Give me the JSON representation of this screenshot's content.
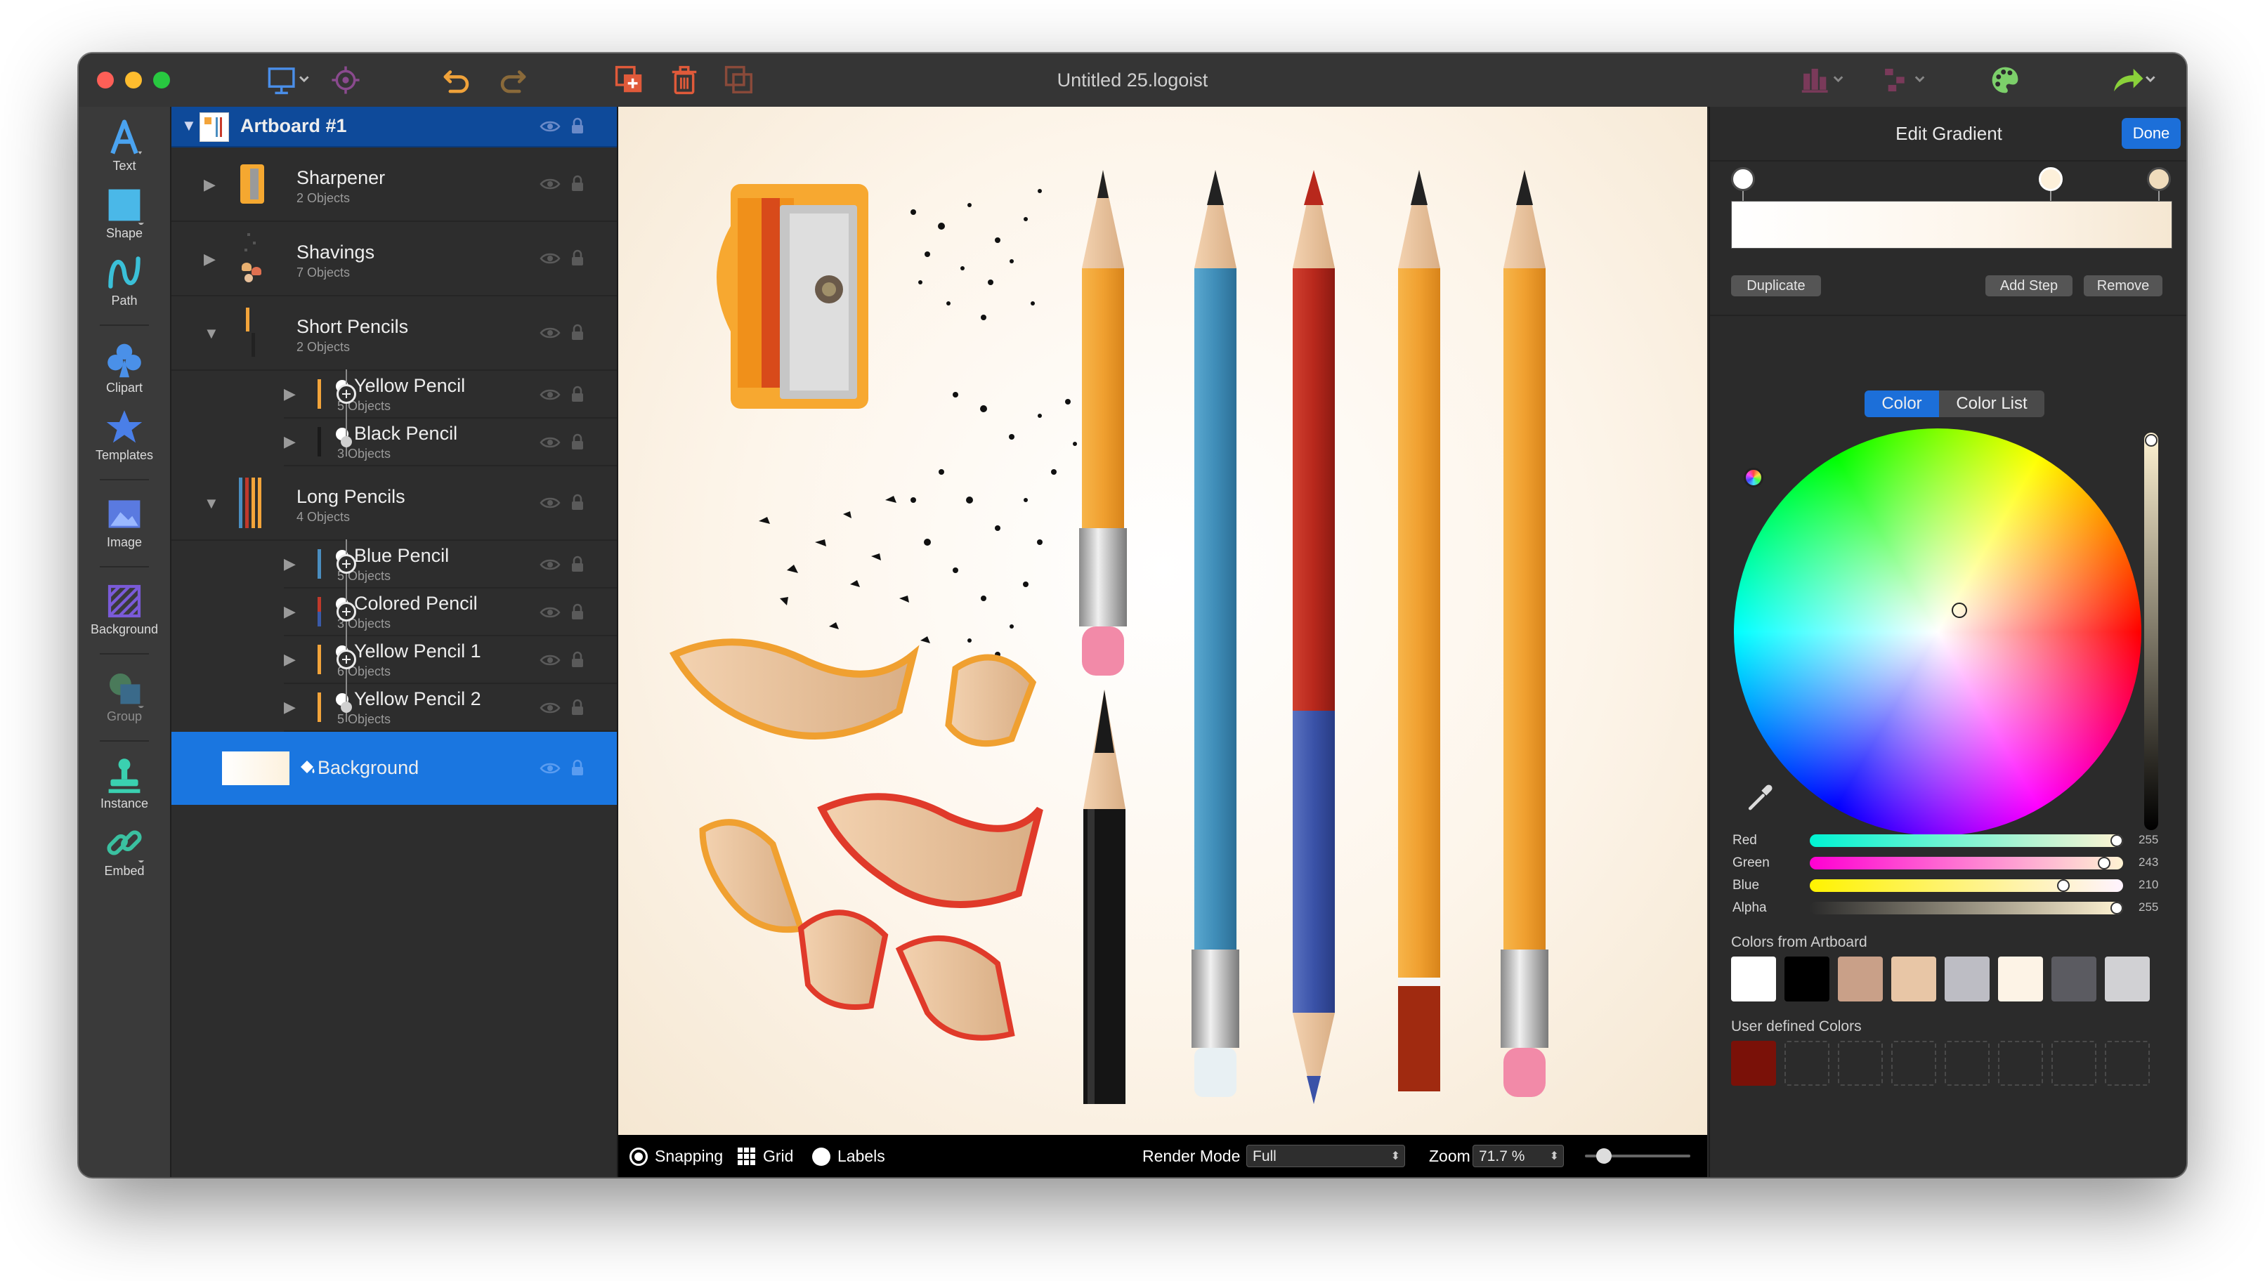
{
  "window": {
    "title": "Untitled 25.logoist"
  },
  "tools": [
    {
      "label": "Text"
    },
    {
      "label": "Shape"
    },
    {
      "label": "Path"
    },
    {
      "label": "Clipart"
    },
    {
      "label": "Templates"
    },
    {
      "label": "Image"
    },
    {
      "label": "Background"
    },
    {
      "label": "Group"
    },
    {
      "label": "Instance"
    },
    {
      "label": "Embed"
    }
  ],
  "layers": {
    "artboard": "Artboard #1",
    "items": [
      {
        "name": "Sharpener",
        "sub": "2 Objects"
      },
      {
        "name": "Shavings",
        "sub": "7 Objects"
      },
      {
        "name": "Short Pencils",
        "sub": "2 Objects"
      },
      {
        "name": "Yellow Pencil",
        "sub": "5 Objects"
      },
      {
        "name": "Black Pencil",
        "sub": "3 Objects"
      },
      {
        "name": "Long Pencils",
        "sub": "4 Objects"
      },
      {
        "name": "Blue Pencil",
        "sub": "5 Objects"
      },
      {
        "name": "Colored Pencil",
        "sub": "3 Objects"
      },
      {
        "name": "Yellow Pencil 1",
        "sub": "6 Objects"
      },
      {
        "name": "Yellow Pencil 2",
        "sub": "5 Objects"
      },
      {
        "name": "Background",
        "sub": ""
      }
    ]
  },
  "bottombar": {
    "snapping": "Snapping",
    "grid": "Grid",
    "labels": "Labels",
    "render_mode_label": "Render Mode",
    "render_mode_value": "Full",
    "zoom_label": "Zoom",
    "zoom_value": "71.7 %"
  },
  "gradient_panel": {
    "title": "Edit Gradient",
    "done": "Done",
    "duplicate": "Duplicate",
    "add_step": "Add Step",
    "remove": "Remove",
    "tab_color": "Color",
    "tab_color_list": "Color List",
    "sliders": [
      {
        "label": "Red",
        "value": "255"
      },
      {
        "label": "Green",
        "value": "243"
      },
      {
        "label": "Blue",
        "value": "210"
      },
      {
        "label": "Alpha",
        "value": "255"
      }
    ],
    "colors_from_artboard_label": "Colors from Artboard",
    "user_defined_label": "User defined Colors",
    "artboard_colors": [
      "#ffffff",
      "#000000",
      "#c9a088",
      "#e8c6a6",
      "#bdbdc4",
      "#fdf3e6",
      "#5b5b61",
      "#d1d1d4"
    ],
    "user_colors": [
      "#7a1108"
    ]
  },
  "colors": {
    "accent": "#1c6fd9",
    "selection": "#1a76e0"
  }
}
